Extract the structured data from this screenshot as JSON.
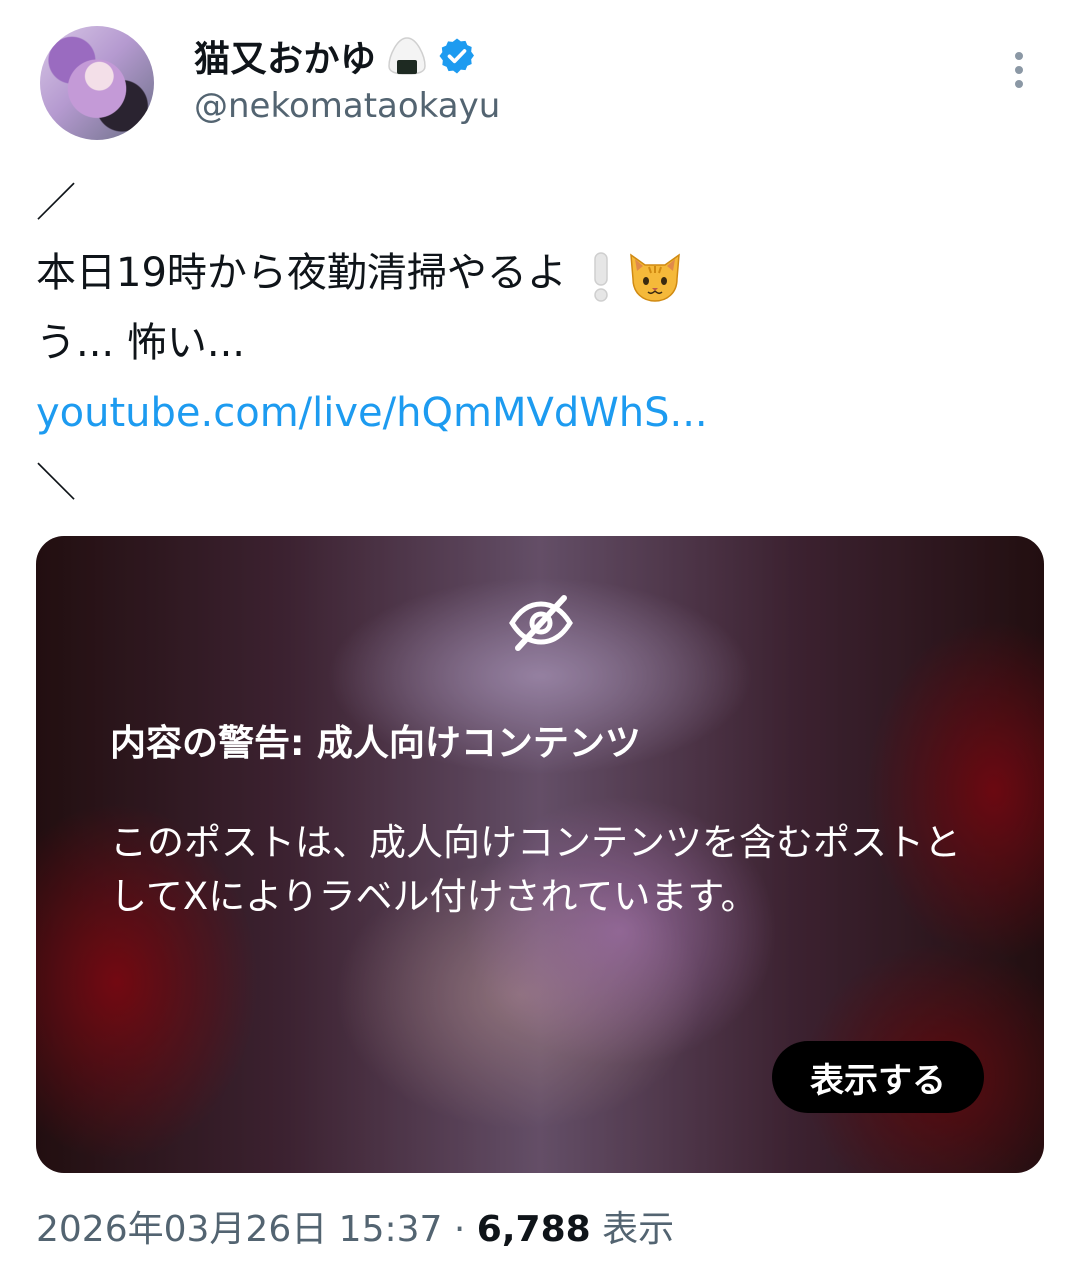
{
  "author": {
    "display_name": "猫又おかゆ",
    "handle": "@nekomataokayu",
    "verified_icon": "verified-badge-icon",
    "name_emoji": "onigiri-icon",
    "accent_color": "#1d9bf0"
  },
  "tweet": {
    "line_slash_open": "／",
    "line_1": "本日19時から夜勤清掃やるよ",
    "line_1_emojis": [
      "exclamation-icon",
      "cat-face-icon"
    ],
    "line_2": "う... 怖い...",
    "link": "youtube.com/live/hQmMVdWhS...",
    "line_slash_close": "＼"
  },
  "media_warning": {
    "icon": "eye-slash-icon",
    "title": "内容の警告: 成人向けコンテンツ",
    "body": "このポストは、成人向けコンテンツを含むポストとしてXによりラベル付けされています。",
    "show_button": "表示する"
  },
  "meta": {
    "timestamp": "2026年03月26日 15:37",
    "separator": "·",
    "views_count": "6,788",
    "views_label": "表示"
  },
  "menu": {
    "icon": "more-vertical-icon"
  }
}
